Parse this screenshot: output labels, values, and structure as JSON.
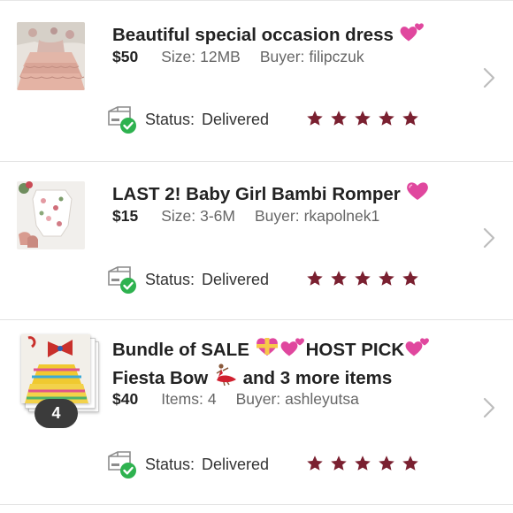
{
  "orders": [
    {
      "title": "Beautiful special occasion dress",
      "price": "$50",
      "attr_label": "Size:",
      "attr_value": "12MB",
      "buyer_label": "Buyer:",
      "buyer": "filipczuk",
      "status_label": "Status:",
      "status": "Delivered",
      "rating": 5
    },
    {
      "title": "LAST 2! Baby Girl Bambi Romper",
      "price": "$15",
      "attr_label": "Size:",
      "attr_value": "3-6M",
      "buyer_label": "Buyer:",
      "buyer": "rkapolnek1",
      "status_label": "Status:",
      "status": "Delivered",
      "rating": 5
    },
    {
      "title_line1_a": "Bundle of SALE",
      "title_line1_b": "HOST PICK",
      "title_line2_a": "Fiesta Bow",
      "title_line2_b": "and 3 more items",
      "price": "$40",
      "attr_label": "Items:",
      "attr_value": "4",
      "buyer_label": "Buyer:",
      "buyer": "ashleyutsa",
      "status_label": "Status:",
      "status": "Delivered",
      "rating": 5,
      "bundle_count": "4"
    }
  ],
  "colors": {
    "star": "#7a2030",
    "check": "#2eb24f",
    "heart": "#e0479e"
  }
}
